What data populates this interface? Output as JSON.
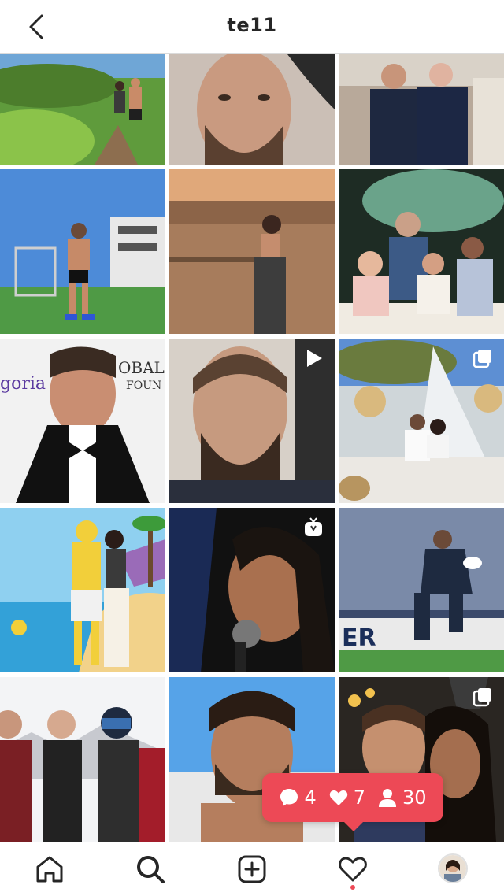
{
  "header": {
    "title": "te11"
  },
  "notification": {
    "comments": "4",
    "likes": "7",
    "follows": "30"
  },
  "colors": {
    "accent": "#ed4956",
    "text": "#262626",
    "divider": "#dbdbdb"
  },
  "icons": {
    "back": "chevron-left-icon",
    "video": "play-icon",
    "carousel": "carousel-icon",
    "igtv": "igtv-icon",
    "home": "home-icon",
    "search": "search-icon",
    "add": "add-post-icon",
    "activity": "heart-icon",
    "profile": "avatar"
  }
}
